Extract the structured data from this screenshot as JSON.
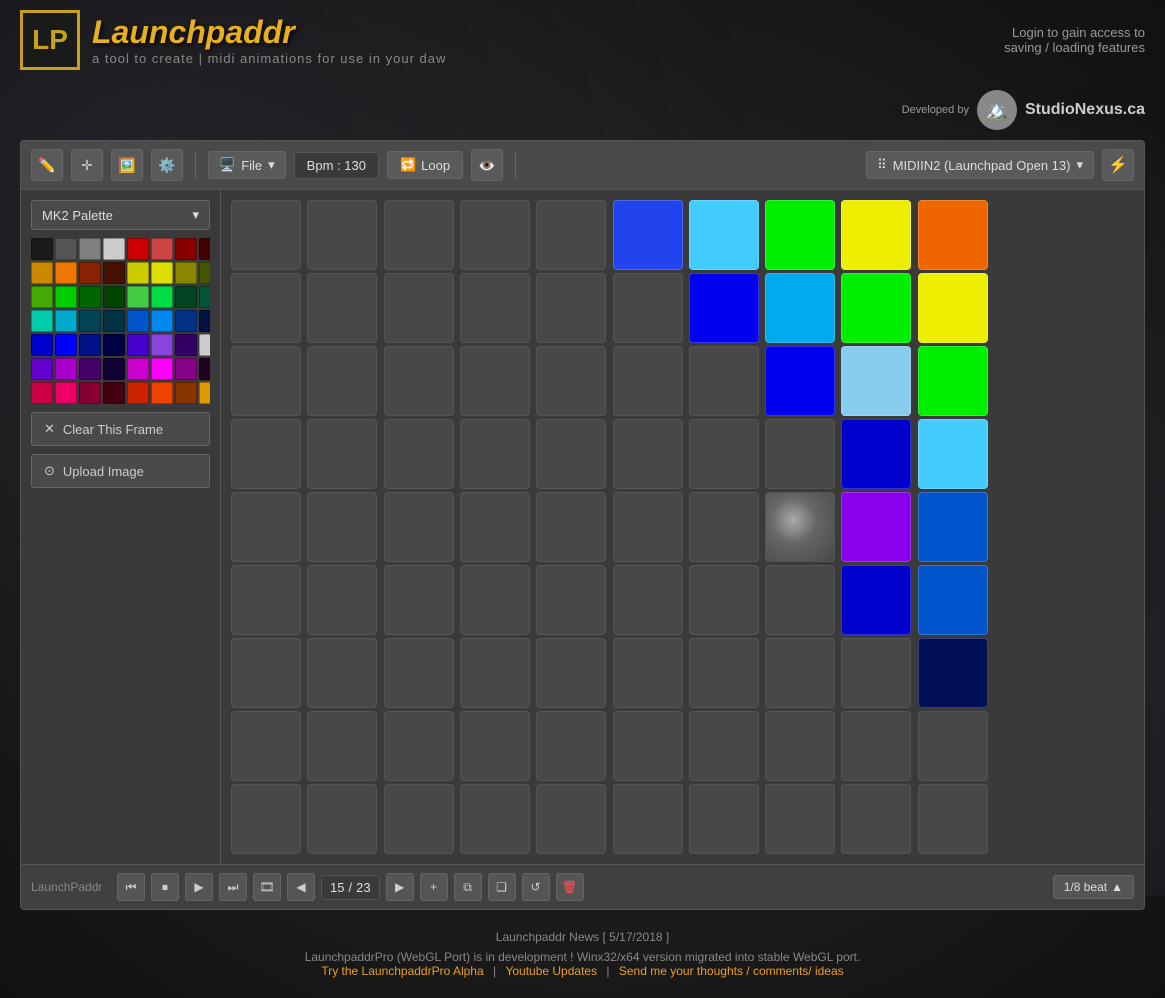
{
  "header": {
    "logo_letters": "LP",
    "logo_title": "Launchpaddr",
    "logo_subtitle": "a tool to create  |  midi animations for use in your daw",
    "login_text": "Login to gain access to\nsaving / loading features"
  },
  "toolbar": {
    "file_label": "File",
    "bpm_label": "Bpm : 130",
    "loop_label": "Loop",
    "midi_label": "MIDIIN2 (Launchpad Open 13)"
  },
  "palette": {
    "dropdown_label": "MK2 Palette",
    "colors": [
      "#1a1a1a",
      "#555555",
      "#808080",
      "#ffffff",
      "#cc0000",
      "#880000",
      "#440000",
      "#cc8800",
      "#ee8800",
      "#884400",
      "#441100",
      "#cccc00",
      "#dddd00",
      "#888800",
      "#444400",
      "#00cc00",
      "#00dd00",
      "#008800",
      "#004400",
      "#00cc44",
      "#00dd44",
      "#00cc88",
      "#00cccc",
      "#008888",
      "#004444",
      "#0088cc",
      "#00aaee",
      "#2200cc",
      "#3300dd",
      "#110088",
      "#110044",
      "#6600cc",
      "#7700ee",
      "#330088",
      "#880088",
      "#cc00cc",
      "#ee00ee",
      "#880044",
      "#440022",
      "#cc0044",
      "#ee0044",
      "#880000",
      "#aa4400",
      "#664400"
    ]
  },
  "palette_rows": [
    [
      "#1a1a1a",
      "#555555",
      "#808080",
      "#cccccc",
      "#cc0000",
      "#cc4444",
      "#880000",
      "#440000"
    ],
    [
      "#cc8800",
      "#ee7700",
      "#882200",
      "#441100",
      "#cccc00",
      "#dddd00",
      "#888800",
      "#445500"
    ],
    [
      "#44aa00",
      "#00cc00",
      "#006600",
      "#004400",
      "#44cc44",
      "#00dd44",
      "#004422",
      "#005533"
    ],
    [
      "#00ccaa",
      "#00aacc",
      "#004455",
      "#003344",
      "#0055cc",
      "#0088ee",
      "#003388",
      "#001144"
    ],
    [
      "#0000cc",
      "#0000ff",
      "#001188",
      "#000044",
      "#4400cc",
      "#8844dd",
      "#330066",
      "#cccccc"
    ],
    [
      "#6600cc",
      "#aa00cc",
      "#440066",
      "#110033",
      "#cc00cc",
      "#ff00ff",
      "#880088",
      "#220022"
    ],
    [
      "#cc0044",
      "#ee0066",
      "#880033",
      "#440011",
      "#cc2200",
      "#ee4400",
      "#883300",
      "#dd9900",
      "#445500"
    ]
  ],
  "actions": {
    "clear_frame": "Clear This Frame",
    "upload_image": "Upload Image"
  },
  "grid": {
    "rows": 9,
    "cols": 10,
    "colored_cells": [
      {
        "row": 0,
        "col": 5,
        "color": "#2244ee"
      },
      {
        "row": 0,
        "col": 6,
        "color": "#44ccff"
      },
      {
        "row": 0,
        "col": 7,
        "color": "#00ee00"
      },
      {
        "row": 0,
        "col": 8,
        "color": "#eeee00"
      },
      {
        "row": 0,
        "col": 9,
        "color": "#ee6600"
      },
      {
        "row": 0,
        "col": 10,
        "color": "#ee0000"
      },
      {
        "row": 1,
        "col": 6,
        "color": "#0000ee"
      },
      {
        "row": 1,
        "col": 7,
        "color": "#00aaee"
      },
      {
        "row": 1,
        "col": 8,
        "color": "#00ee00"
      },
      {
        "row": 1,
        "col": 9,
        "color": "#eeee00"
      },
      {
        "row": 1,
        "col": 10,
        "color": "#ee6600"
      },
      {
        "row": 2,
        "col": 7,
        "color": "#0000ee"
      },
      {
        "row": 2,
        "col": 8,
        "color": "#88ccee"
      },
      {
        "row": 2,
        "col": 9,
        "color": "#00ee00"
      },
      {
        "row": 2,
        "col": 10,
        "color": "#eeee00"
      },
      {
        "row": 3,
        "col": 8,
        "color": "#0000cc"
      },
      {
        "row": 3,
        "col": 9,
        "color": "#44ccff"
      },
      {
        "row": 3,
        "col": 10,
        "color": "#00ee00"
      },
      {
        "row": 4,
        "col": 8,
        "color": "#8800ff"
      },
      {
        "row": 4,
        "col": 9,
        "color": "#0055cc"
      },
      {
        "row": 4,
        "col": 10,
        "color": "#00cccc"
      },
      {
        "row": 5,
        "col": 9,
        "color": "#0000cc"
      },
      {
        "row": 5,
        "col": 10,
        "color": "#0055cc"
      },
      {
        "row": 6,
        "col": 9,
        "color": "#001155"
      },
      {
        "row": 6,
        "col": 10,
        "color": "#0000cc"
      }
    ]
  },
  "transport": {
    "label": "LaunchPaddr",
    "frame_current": "15",
    "frame_total": "23",
    "beat_label": "1/8 beat"
  },
  "footer": {
    "news": "Launchpaddr News [ 5/17/2018 ]",
    "pro_notice": "LaunchpaddrPro (WebGL Port) is in development ! Winx32/x64 version migrated into stable WebGL port.",
    "link_alpha": "Try the LaunchpaddrPro Alpha",
    "link_youtube": "Youtube Updates",
    "link_feedback": "Send me your thoughts / comments/ ideas",
    "studio_developed": "Developed by",
    "studio_name": "StudioNexus.ca"
  }
}
